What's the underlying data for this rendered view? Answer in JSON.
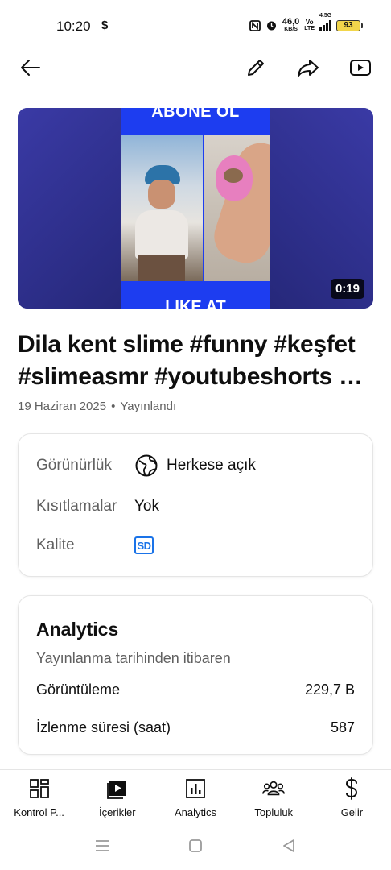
{
  "status_bar": {
    "time": "10:20",
    "money_icon": "$",
    "net_speed_value": "46,0",
    "net_speed_unit": "KB/S",
    "volte_top": "Vo",
    "volte_bottom": "LTE",
    "signal_type": "4.5G",
    "battery": "93"
  },
  "top_bar": {
    "icons": [
      "back-arrow-icon",
      "edit-pencil-icon",
      "share-icon",
      "youtube-open-icon"
    ]
  },
  "video": {
    "thumb_top_text": "ABONE OL",
    "thumb_bottom_text": "LIKE AT",
    "duration": "0:19",
    "title_line1": "Dila kent slime #funny #keşfet",
    "title_line2": "#slimeasmr #youtubeshorts …",
    "date": "19 Haziran 2025",
    "separator": "•",
    "status": "Yayınlandı"
  },
  "details": {
    "visibility_label": "Görünürlük",
    "visibility_value": "Herkese açık",
    "restrictions_label": "Kısıtlamalar",
    "restrictions_value": "Yok",
    "quality_label": "Kalite",
    "quality_value": "SD"
  },
  "analytics": {
    "title": "Analytics",
    "subtitle": "Yayınlanma tarihinden itibaren",
    "rows": [
      {
        "label": "Görüntüleme",
        "value": "229,7 B"
      },
      {
        "label": "İzlenme süresi (saat)",
        "value": "587"
      }
    ]
  },
  "bottom_nav": [
    {
      "label": "Kontrol P...",
      "icon": "dashboard-icon"
    },
    {
      "label": "İçerikler",
      "icon": "content-icon"
    },
    {
      "label": "Analytics",
      "icon": "analytics-icon"
    },
    {
      "label": "Topluluk",
      "icon": "community-icon"
    },
    {
      "label": "Gelir",
      "icon": "earn-icon"
    }
  ],
  "colors": {
    "accent_blue": "#1a73e8",
    "text_primary": "#0f0f0f",
    "text_secondary": "#606060",
    "battery": "#f2d64b"
  }
}
